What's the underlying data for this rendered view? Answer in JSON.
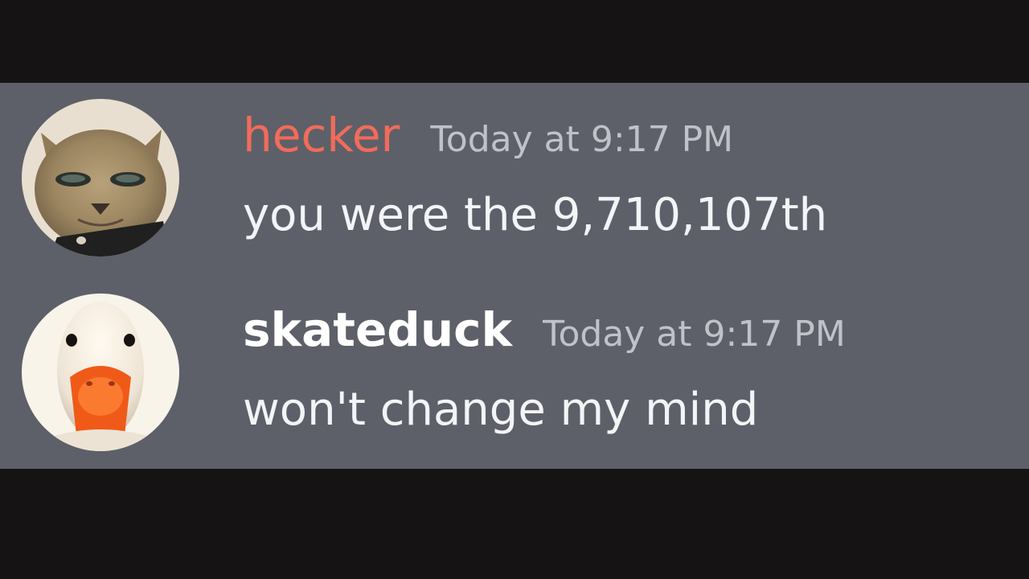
{
  "colors": {
    "background": "#161314",
    "panel": "#5d6068",
    "username_hecker": "#f26b5b",
    "username_skateduck": "#ffffff",
    "timestamp": "#bfc2c8",
    "message_text": "#f3f4f6"
  },
  "messages": [
    {
      "username": "hecker",
      "timestamp": "Today at 9:17 PM",
      "text": "you were the 9,710,107th",
      "avatar_icon": "cat-avatar-icon"
    },
    {
      "username": "skateduck",
      "timestamp": "Today at 9:17 PM",
      "text": "won't change my mind",
      "avatar_icon": "duck-avatar-icon"
    }
  ]
}
